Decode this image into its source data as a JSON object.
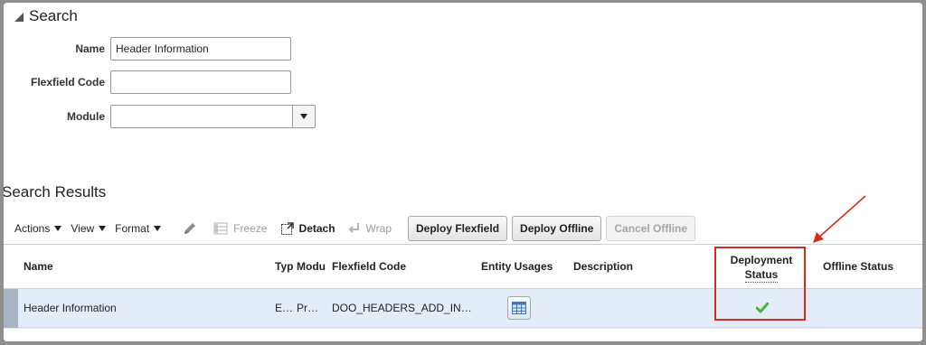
{
  "search": {
    "title": "Search",
    "name_label": "Name",
    "name_value": "Header Information",
    "flexfield_code_label": "Flexfield Code",
    "flexfield_code_value": "",
    "module_label": "Module",
    "module_value": ""
  },
  "results": {
    "title": "Search Results"
  },
  "toolbar": {
    "actions_label": "Actions",
    "view_label": "View",
    "format_label": "Format",
    "freeze_label": "Freeze",
    "detach_label": "Detach",
    "wrap_label": "Wrap",
    "deploy_flexfield_label": "Deploy Flexfield",
    "deploy_offline_label": "Deploy Offline",
    "cancel_offline_label": "Cancel Offline"
  },
  "table": {
    "columns": {
      "name": "Name",
      "type": "Typ",
      "module": "Modu",
      "flexfield_code": "Flexfield Code",
      "entity_usages": "Entity Usages",
      "description": "Description",
      "deployment_status_line1": "Deployment",
      "deployment_status_line2": "Status",
      "offline_status": "Offline Status"
    },
    "rows": [
      {
        "name": "Header Information",
        "type": "E…",
        "module": "Pr…",
        "flexfield_code": "DOO_HEADERS_ADD_IN…",
        "entity_usages_icon": "table-icon",
        "description": "",
        "deployment_status_icon": "checkmark-icon",
        "offline_status": ""
      }
    ]
  },
  "colors": {
    "selected_row": "#e4ecf7",
    "highlight": "#d42b20",
    "check": "#4caf3a"
  }
}
